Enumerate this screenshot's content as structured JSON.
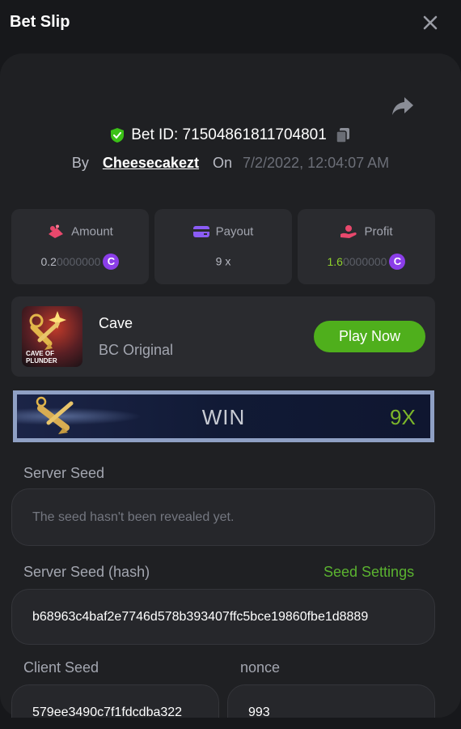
{
  "header": {
    "title": "Bet Slip"
  },
  "bet": {
    "id_label": "Bet ID: 71504861811704801",
    "by_label": "By",
    "username": "Cheesecakezt",
    "on_label": "On",
    "date": "7/2/2022, 12:04:07 AM"
  },
  "stats": {
    "amount": {
      "label": "Amount",
      "value_main": "0.2",
      "value_faint": "0000000",
      "icon": "bet-chips-icon",
      "coin": "C"
    },
    "payout": {
      "label": "Payout",
      "value": "9 x",
      "icon": "wallet-icon"
    },
    "profit": {
      "label": "Profit",
      "value_main": "1.6",
      "value_faint": "0000000",
      "icon": "hand-coin-icon",
      "coin": "C"
    }
  },
  "game": {
    "name": "Cave",
    "provider": "BC Original",
    "play_label": "Play Now",
    "thumb_text_1": "CAVE OF",
    "thumb_text_2": "PLUNDER"
  },
  "result": {
    "status": "WIN",
    "multiplier": "9X"
  },
  "seeds": {
    "server_seed_label": "Server Seed",
    "server_seed_value": "The seed hasn't been revealed yet.",
    "server_hash_label": "Server Seed (hash)",
    "seed_settings_label": "Seed Settings",
    "server_hash_value": "b68963c4baf2e7746d578b393407ffc5bce19860fbe1d8889",
    "client_seed_label": "Client Seed",
    "client_seed_value": "579ee3490c7f1fdcdba322",
    "nonce_label": "nonce",
    "nonce_value": "993"
  },
  "colors": {
    "background": "#17181b",
    "panel": "#1f2023",
    "card": "#2a2b2f",
    "accent_green": "#4faf1c",
    "coin_purple": "#8b3ee9",
    "profit_green": "#8fd22c"
  }
}
